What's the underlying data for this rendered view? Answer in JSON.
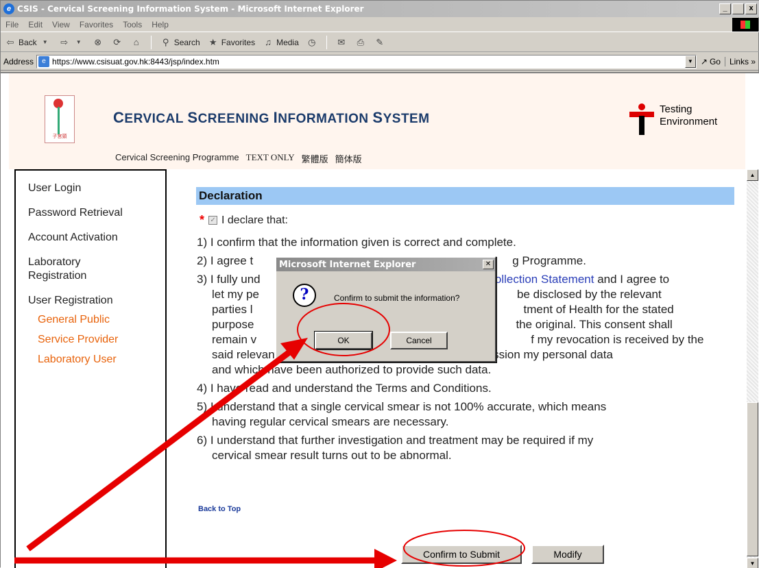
{
  "window": {
    "title": "CSIS - Cervical Screening Information System - Microsoft Internet Explorer",
    "min": "_",
    "max": " ",
    "close": "x"
  },
  "menu": [
    "File",
    "Edit",
    "View",
    "Favorites",
    "Tools",
    "Help"
  ],
  "toolbar": {
    "back": "Back",
    "search": "Search",
    "favorites": "Favorites",
    "media": "Media"
  },
  "address": {
    "label": "Address",
    "url": "https://www.csisuat.gov.hk:8443/jsp/index.htm",
    "go": "Go",
    "links": "Links"
  },
  "header": {
    "title_c": "C",
    "title_1": "ERVICAL ",
    "title_s": "S",
    "title_2": "CREENING ",
    "title_i": "I",
    "title_3": "NFORMATION ",
    "title_s2": "S",
    "title_4": "YSTEM",
    "links": {
      "programme": "Cervical Screening Programme",
      "text_only": "TEXT ONLY",
      "trad": "繁體版",
      "simp": "簡体版"
    },
    "testing_1": "Testing",
    "testing_2": "Environment"
  },
  "sidebar": {
    "items": [
      {
        "label": "User Login"
      },
      {
        "label": "Password Retrieval"
      },
      {
        "label": "Account Activation"
      },
      {
        "label": "Laboratory Registration"
      },
      {
        "label": "User Registration"
      }
    ],
    "sub": [
      {
        "label": "General Public"
      },
      {
        "label": "Service Provider"
      },
      {
        "label": "Laboratory User"
      }
    ]
  },
  "declaration": {
    "heading": "Declaration",
    "declare": "I declare that:",
    "item1": "1) I confirm that the information given is correct and complete.",
    "item2a": "2) I agree t",
    "item2b": "g Programme.",
    "item3a": "3) I fully und",
    "item3link": "Collection Statement",
    "item3b": " and I agree to",
    "item3c": "let my pe",
    "item3d": "be disclosed by the relevant",
    "item3e": "parties l",
    "item3f": "tment of Health for the stated",
    "item3g": "purpose",
    "item3h": "the original. This consent shall",
    "item3i": "remain v",
    "item3j": "f my revocation is received by the",
    "item3k": "said relevant parties which actually have in their possession my personal data",
    "item3l": "and which have been authorized to provide such data.",
    "item4": "4) I have read and understand the Terms and Conditions.",
    "item5a": "5) I understand that a single cervical smear is not 100% accurate, which means",
    "item5b": "having regular cervical smears are necessary.",
    "item6a": "6) I understand that further investigation and treatment may be required if my",
    "item6b": "cervical smear result turns out to be abnormal.",
    "back_to_top": "Back to Top",
    "confirm_button": "Confirm to Submit",
    "modify_button": "Modify"
  },
  "dialog": {
    "title": "Microsoft Internet Explorer",
    "message": "Confirm to submit the information?",
    "ok": "OK",
    "cancel": "Cancel"
  },
  "annotation_color": "#e60000"
}
